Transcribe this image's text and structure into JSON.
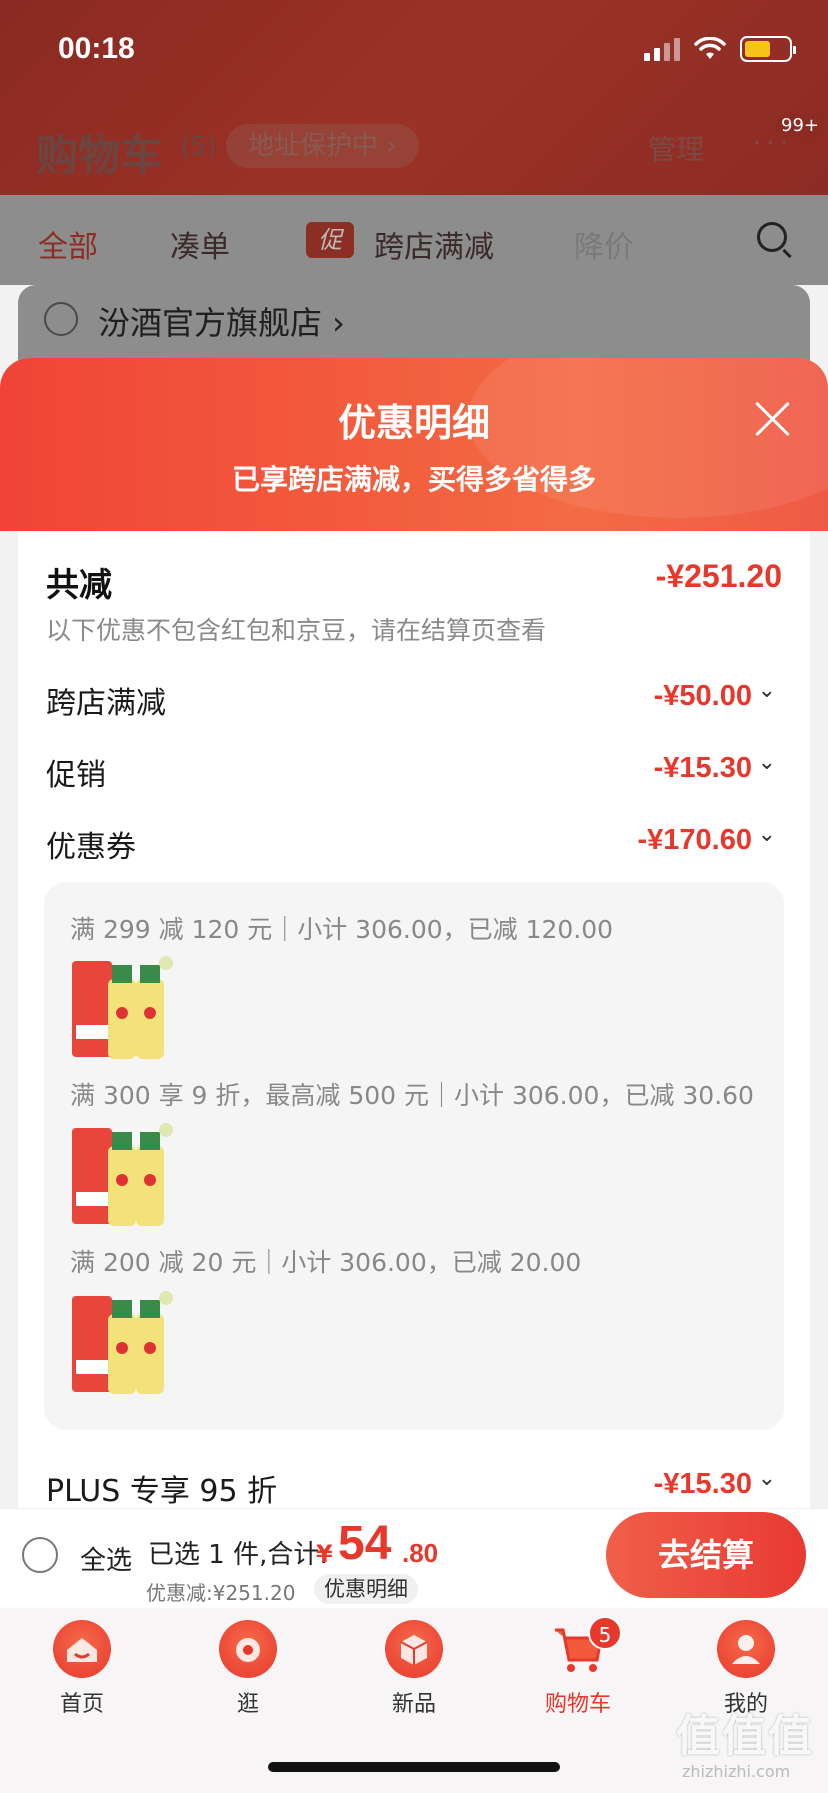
{
  "status_bar": {
    "time": "00:18"
  },
  "header": {
    "title": "购物车",
    "count": "(5)",
    "address_pill": "地址保护中 ›",
    "manage": "管理",
    "more_badge": "99+"
  },
  "tabs": [
    "全部",
    "凑单",
    "跨店满减",
    "降价"
  ],
  "promo_tag": "促",
  "store": {
    "name": "汾酒官方旗舰店 ›"
  },
  "sheet": {
    "title": "优惠明细",
    "subtitle": "已享跨店满减，买得多省得多",
    "total_label": "共减",
    "total_value": "-¥251.20",
    "note": "以下优惠不包含红包和京豆，请在结算页查看",
    "rows": [
      {
        "label": "跨店满减",
        "value": "-¥50.00"
      },
      {
        "label": "促销",
        "value": "-¥15.30"
      },
      {
        "label": "优惠券",
        "value": "-¥170.60"
      }
    ],
    "coupon_lines": [
      "满 299 减 120 元｜小计 306.00，已减 120.00",
      "满 300 享 9 折，最高减 500 元｜小计 306.00，已减 30.60",
      "满 200 减 20 元｜小计 306.00，已减 20.00"
    ],
    "plus_row": {
      "label": "PLUS 专享 95 折",
      "value": "-¥15.30"
    }
  },
  "bottom_bar": {
    "select_all": "全选",
    "selected_text": "已选 1 件,合计:",
    "price_symbol": "¥",
    "price_int": "54",
    "price_dec": ".80",
    "discount_text": "优惠减:¥251.20",
    "detail_link": "优惠明细",
    "checkout": "去结算"
  },
  "nav": [
    {
      "label": "首页",
      "icon": "home-icon"
    },
    {
      "label": "逛",
      "icon": "browse-icon"
    },
    {
      "label": "新品",
      "icon": "new-products-icon"
    },
    {
      "label": "购物车",
      "icon": "cart-icon"
    },
    {
      "label": "我的",
      "icon": "profile-icon"
    }
  ],
  "cart_badge": "5",
  "watermark": {
    "main": "值值值",
    "sub": "zhizhizhi.com"
  },
  "colors": {
    "accent": "#e8382c",
    "header_gradient": "#f04438",
    "dim_header": "#9b3227"
  }
}
